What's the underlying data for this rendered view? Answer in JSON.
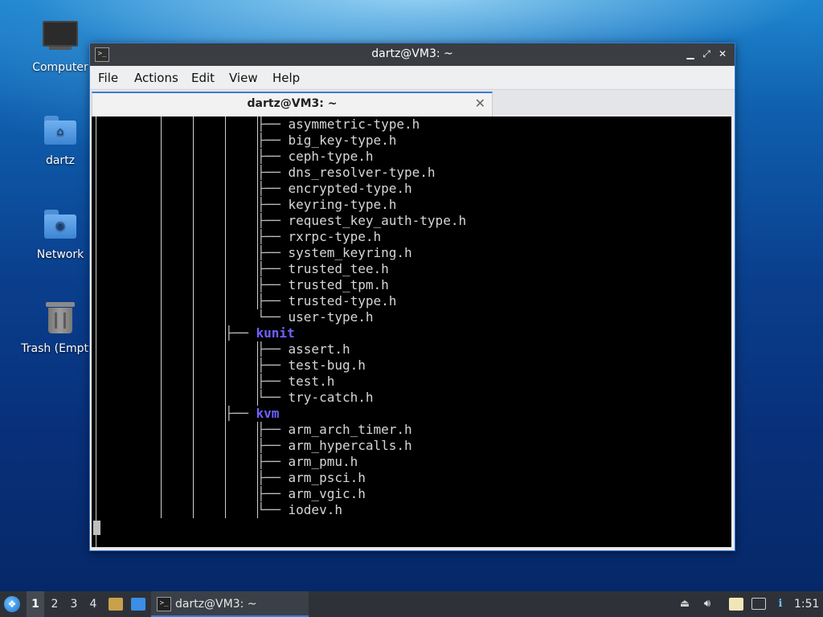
{
  "desktop": {
    "icons": [
      {
        "label": "Computer",
        "icon": "computer-icon"
      },
      {
        "label": "dartz",
        "icon": "home-folder-icon"
      },
      {
        "label": "Network",
        "icon": "network-folder-icon"
      },
      {
        "label": "Trash (Empty)",
        "icon": "trash-icon"
      }
    ]
  },
  "window": {
    "title": "dartz@VM3: ~",
    "icon": "terminal-icon",
    "controls": {
      "minimize": "▁",
      "maximize": "⤢",
      "close": "✕"
    },
    "menu": [
      "File",
      "Actions",
      "Edit",
      "View",
      "Help"
    ],
    "tab": {
      "label": "dartz@VM3: ~",
      "close": "✕"
    }
  },
  "terminal": {
    "lines": [
      {
        "branch": "├── ",
        "name": "asymmetric-type.h"
      },
      {
        "branch": "├── ",
        "name": "big_key-type.h"
      },
      {
        "branch": "├── ",
        "name": "ceph-type.h"
      },
      {
        "branch": "├── ",
        "name": "dns_resolver-type.h"
      },
      {
        "branch": "├── ",
        "name": "encrypted-type.h"
      },
      {
        "branch": "├── ",
        "name": "keyring-type.h"
      },
      {
        "branch": "├── ",
        "name": "request_key_auth-type.h"
      },
      {
        "branch": "├── ",
        "name": "rxrpc-type.h"
      },
      {
        "branch": "├── ",
        "name": "system_keyring.h"
      },
      {
        "branch": "├── ",
        "name": "trusted_tee.h"
      },
      {
        "branch": "├── ",
        "name": "trusted_tpm.h"
      },
      {
        "branch": "├── ",
        "name": "trusted-type.h"
      },
      {
        "branch": "└── ",
        "name": "user-type.h"
      },
      {
        "branch": "├── ",
        "name": "kunit",
        "dir": true
      },
      {
        "branch": "├── ",
        "name": "assert.h"
      },
      {
        "branch": "├── ",
        "name": "test-bug.h"
      },
      {
        "branch": "├── ",
        "name": "test.h"
      },
      {
        "branch": "└── ",
        "name": "try-catch.h"
      },
      {
        "branch": "├── ",
        "name": "kvm",
        "dir": true
      },
      {
        "branch": "├── ",
        "name": "arm_arch_timer.h"
      },
      {
        "branch": "├── ",
        "name": "arm_hypercalls.h"
      },
      {
        "branch": "├── ",
        "name": "arm_pmu.h"
      },
      {
        "branch": "├── ",
        "name": "arm_psci.h"
      },
      {
        "branch": "├── ",
        "name": "arm_vgic.h"
      },
      {
        "branch": "└── ",
        "name": "iodev.h"
      }
    ],
    "colors": {
      "background": "#000000",
      "text": "#d6d6d6",
      "directory": "#6f62ff"
    }
  },
  "taskbar": {
    "start_icon": "lubuntu-start-icon",
    "workspaces": [
      "1",
      "2",
      "3",
      "4"
    ],
    "active_workspace": "1",
    "quick_launch": [
      "file-manager-icon",
      "show-desktop-icon"
    ],
    "task": {
      "label": "dartz@VM3: ~",
      "icon": "terminal-icon"
    },
    "tray": [
      "eject-icon",
      "volume-icon",
      "clipboard-icon",
      "network-icon",
      "update-notifier-icon"
    ],
    "clock": "1:51"
  }
}
